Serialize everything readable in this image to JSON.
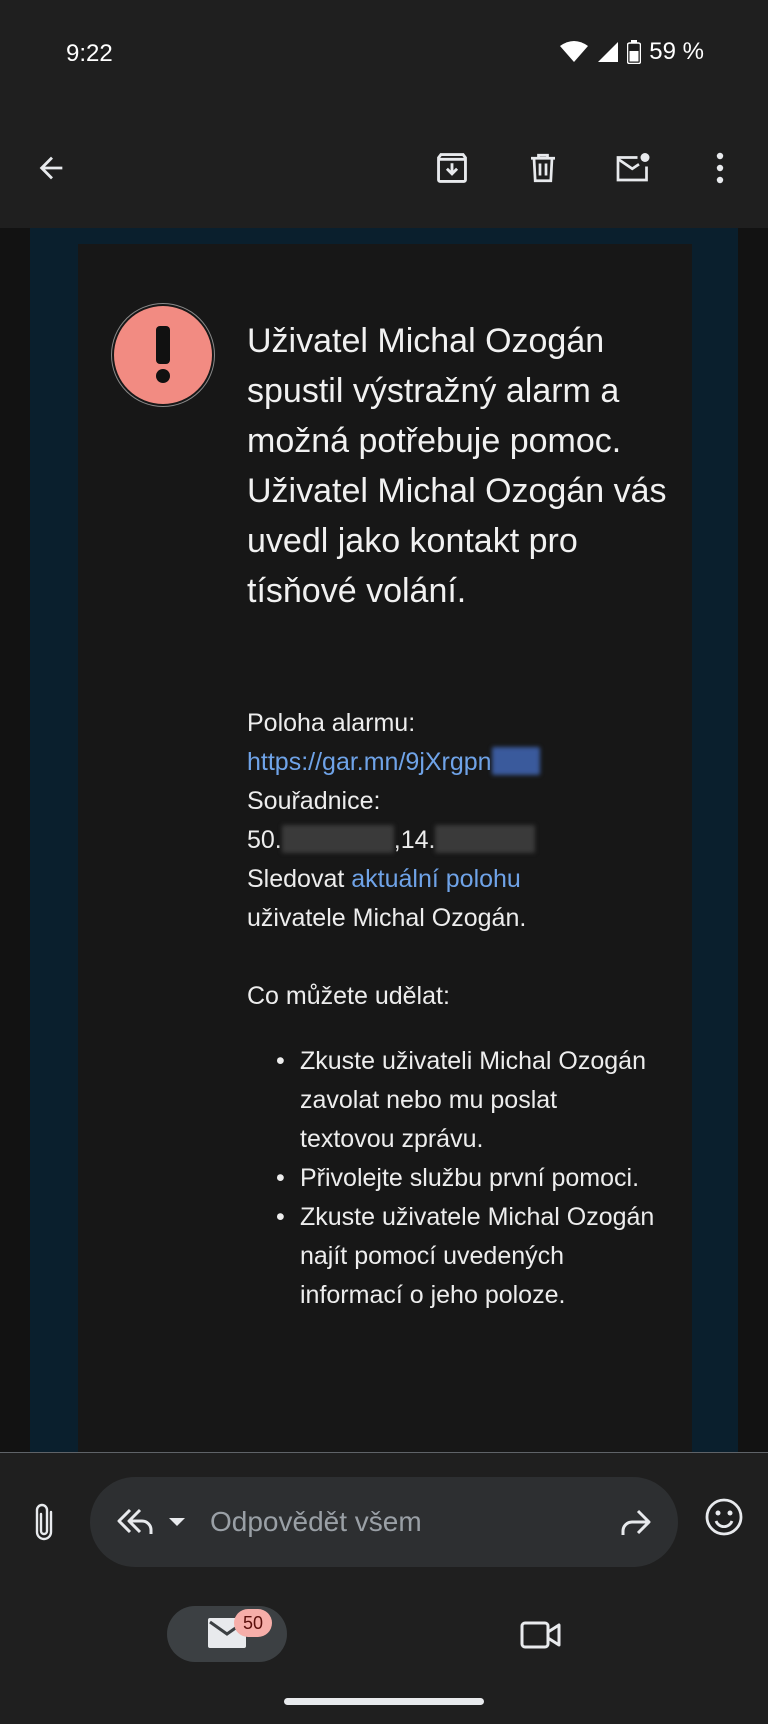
{
  "status_bar": {
    "time": "9:22",
    "battery": "59 %"
  },
  "toolbar": {
    "icons": [
      "back-arrow-icon",
      "archive-icon",
      "delete-icon",
      "mark-unread-icon",
      "more-vert-icon"
    ]
  },
  "email": {
    "alert_icon": "exclamation-icon",
    "headline": "Uživatel Michal Ozogán spustil výstražný alarm a možná potřebuje pomoc. Uživatel Michal Ozogán vás uvedl jako kontakt pro tísňové volání.",
    "location_label": "Poloha alarmu:",
    "location_link": "https://gar.mn/9jXrgpn",
    "coordinates_label": "Souřadnice:",
    "coord_lat_prefix": "50.",
    "coord_separator": ",14.",
    "track_prefix": "Sledovat",
    "track_link": "aktuální polohu",
    "track_suffix": "uživatele Michal Ozogán.",
    "what_you_can_do": "Co můžete udělat:",
    "steps": [
      "Zkuste uživateli Michal Ozogán zavolat nebo mu poslat textovou zprávu.",
      "Přivolejte službu první pomoci.",
      "Zkuste uživatele Michal Ozogán najít pomocí uvedených informací o jeho poloze."
    ]
  },
  "compose": {
    "reply_placeholder": "Odpovědět všem"
  },
  "bottom_nav": {
    "mail_badge": "50"
  },
  "colors": {
    "link": "#6fa3e8",
    "alert": "#f28b82",
    "badge": "#f6aea9",
    "background": "#1f1f1f"
  }
}
